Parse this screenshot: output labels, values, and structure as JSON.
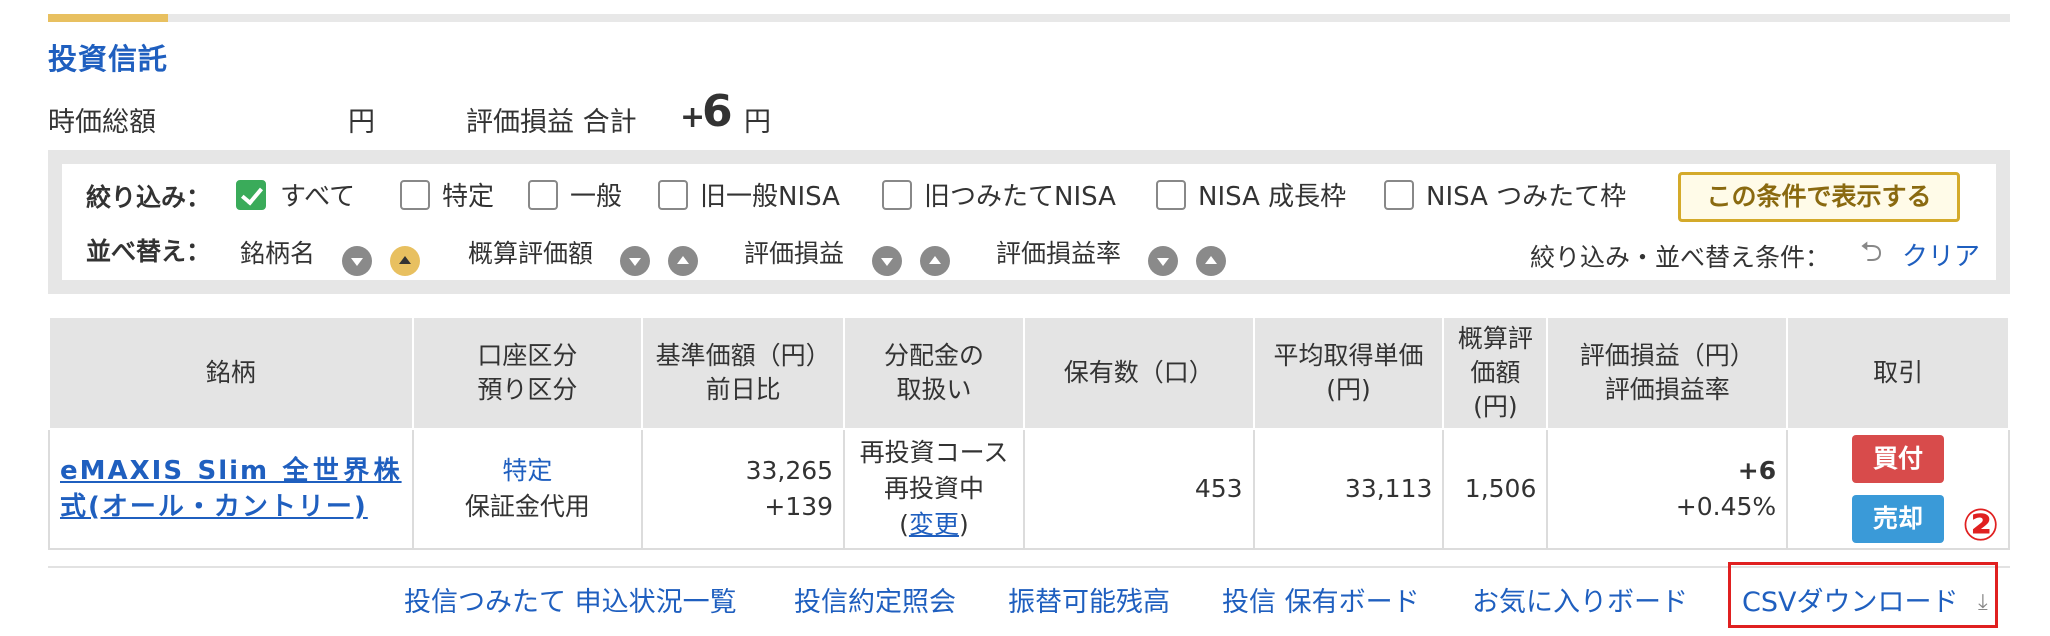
{
  "section": {
    "title": "投資信託"
  },
  "summary": {
    "market_value_label": "時価総額",
    "market_value_unit": "円",
    "pl_label": "評価損益 合計",
    "pl_sign": "+",
    "pl_value": "6",
    "pl_unit": "円"
  },
  "filter": {
    "label": "絞り込み：",
    "options": [
      {
        "label": "すべて",
        "checked": true
      },
      {
        "label": "特定",
        "checked": false
      },
      {
        "label": "一般",
        "checked": false
      },
      {
        "label": "旧一般NISA",
        "checked": false
      },
      {
        "label": "旧つみたてNISA",
        "checked": false
      },
      {
        "label": "NISA 成長枠",
        "checked": false
      },
      {
        "label": "NISA つみたて枠",
        "checked": false
      }
    ],
    "apply_label": "この条件で表示する"
  },
  "sort": {
    "label": "並べ替え：",
    "fields": [
      "銘柄名",
      "概算評価額",
      "評価損益",
      "評価損益率"
    ],
    "active": "銘柄名 ascending",
    "conditions_label": "絞り込み・並べ替え条件：",
    "clear_label": "クリア"
  },
  "table": {
    "headers": {
      "fund": "銘柄",
      "account_1": "口座区分",
      "account_2": "預り区分",
      "nav_1": "基準価額（円）",
      "nav_2": "前日比",
      "dist_1": "分配金の",
      "dist_2": "取扱い",
      "holdings": "保有数（口）",
      "avg_1": "平均取得単価",
      "avg_2": "(円)",
      "est_1": "概算評",
      "est_2": "価額",
      "est_3": "(円)",
      "pl_1": "評価損益（円）",
      "pl_2": "評価損益率",
      "trade": "取引"
    },
    "rows": [
      {
        "fund_name": "eMAXIS Slim 全世界株式(オール・カントリー)",
        "account": "特定",
        "deposit": "保証金代用",
        "nav": "33,265",
        "nav_change": "+139",
        "dist_1": "再投資コース",
        "dist_2": "再投資中",
        "dist_open": "(",
        "dist_change": "変更",
        "dist_close": ")",
        "holdings": "453",
        "avg_price": "33,113",
        "est_value": "1,506",
        "pl": "+6",
        "pl_rate": "+0.45%",
        "buy_label": "買付",
        "sell_label": "売却"
      }
    ]
  },
  "bottom_links": [
    "投信つみたて 申込状況一覧",
    "投信約定照会",
    "振替可能残高",
    "投信 保有ボード",
    "お気に入りボード",
    "CSVダウンロード"
  ],
  "annotation": {
    "marker": "②",
    "color": "#e02020"
  },
  "colors": {
    "link": "#1f5fbf",
    "accent": "#e8c060",
    "buy": "#d84b4b",
    "sell": "#3a9ad8",
    "check": "#3aab5a"
  }
}
